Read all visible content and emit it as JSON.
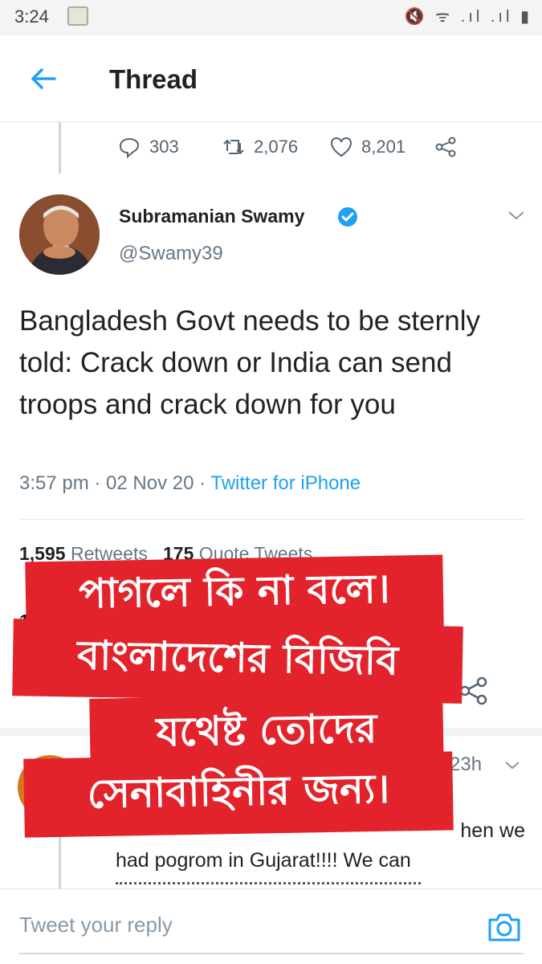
{
  "status_bar": {
    "time": "3:24",
    "icons": [
      "mute-icon",
      "wifi-icon",
      "signal-icon",
      "signal-icon",
      "battery-icon"
    ],
    "icons_text": "🔇 ᯤ .ıl .ıl ▮"
  },
  "header": {
    "title": "Thread",
    "back_icon": "arrow-left-icon"
  },
  "prev_tweet_actions": {
    "replies": "303",
    "retweets": "2,076",
    "likes": "8,201"
  },
  "tweet": {
    "author_name": "Subramanian Swamy",
    "handle": "@Swamy39",
    "text": "Bangladesh Govt needs to be sternly told: Crack down or India can send troops and crack down for you",
    "time": "3:57 pm",
    "date": "02 Nov 20",
    "source": "Twitter for iPhone",
    "retweets_count": "1,595",
    "retweets_label": "Retweets",
    "quote_count": "175",
    "quote_label": "Quote Tweets",
    "likes_count_partial": "1"
  },
  "overlay_banner": [
    "পাগলে কি না বলে।",
    "বাংলাদেশের বিজিবি",
    "যথেষ্ট তোদের",
    "সেনাবাহিনীর জন্য।"
  ],
  "reply": {
    "time": "23h",
    "text_visible_1": "hen we",
    "text_visible_2": "had pogrom in Gujarat!!!! We can"
  },
  "reply_bar": {
    "placeholder": "Tweet your reply",
    "camera_icon": "camera-icon"
  },
  "colors": {
    "twitter_blue": "#1da1f2",
    "banner_red": "#e3232c",
    "muted_text": "#657786"
  }
}
